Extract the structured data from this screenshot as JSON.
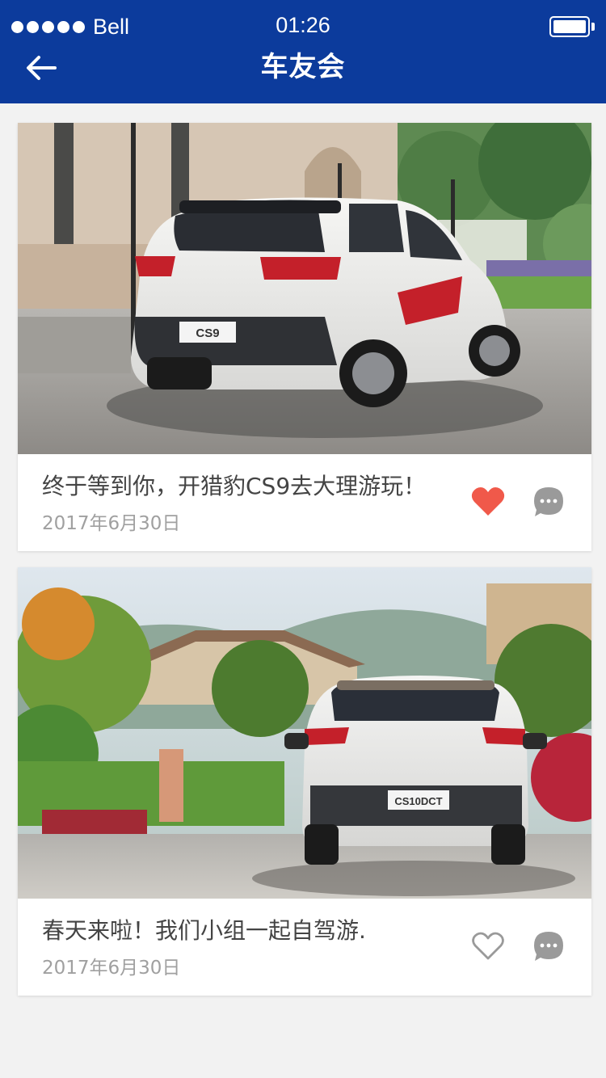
{
  "status_bar": {
    "carrier": "Bell",
    "time": "01:26"
  },
  "header": {
    "title": "车友会"
  },
  "colors": {
    "header_bg": "#0c3b9c",
    "like_active": "#f0594a",
    "icon_gray": "#9a9a9a"
  },
  "posts": [
    {
      "title": "终于等到你，开猎豹CS9去大理游玩！",
      "date": "2017年6月30日",
      "liked": true,
      "plate_text": "CS9",
      "image": "white Leopaard CS9 SUV parked in front of stone building"
    },
    {
      "title": "春天来啦！我们小组一起自驾游.",
      "date": "2017年6月30日",
      "liked": false,
      "plate_text": "CS10DCT",
      "image": "white Leopaard CS10 SUV on road with trees and houses"
    }
  ]
}
